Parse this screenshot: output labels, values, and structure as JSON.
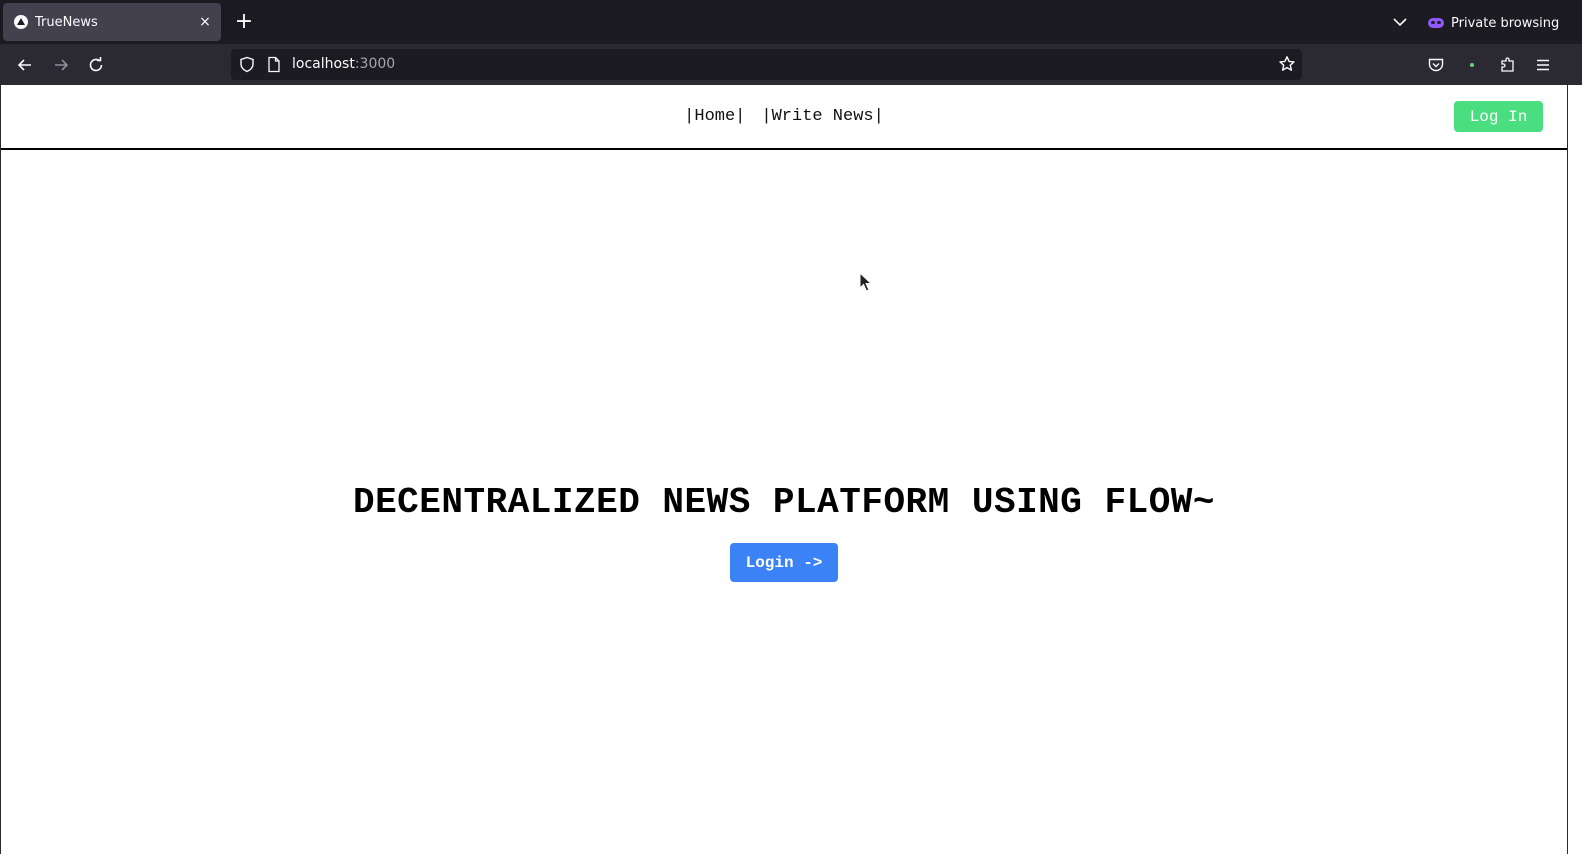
{
  "browser": {
    "tab": {
      "title": "TrueNews",
      "close": "×"
    },
    "new_tab": "+",
    "private_label": "Private browsing",
    "url_host": "localhost",
    "url_port": ":3000"
  },
  "site": {
    "nav": [
      "|Home|",
      "|Write News|"
    ],
    "login_top": "Log In",
    "hero_title": "DECENTRALIZED NEWS PLATFORM USING FLOW~",
    "login_main": "Login ->"
  },
  "colors": {
    "login_top_bg": "#4ade80",
    "login_main_bg": "#3b82f6",
    "private_accent": "#9059ff"
  }
}
